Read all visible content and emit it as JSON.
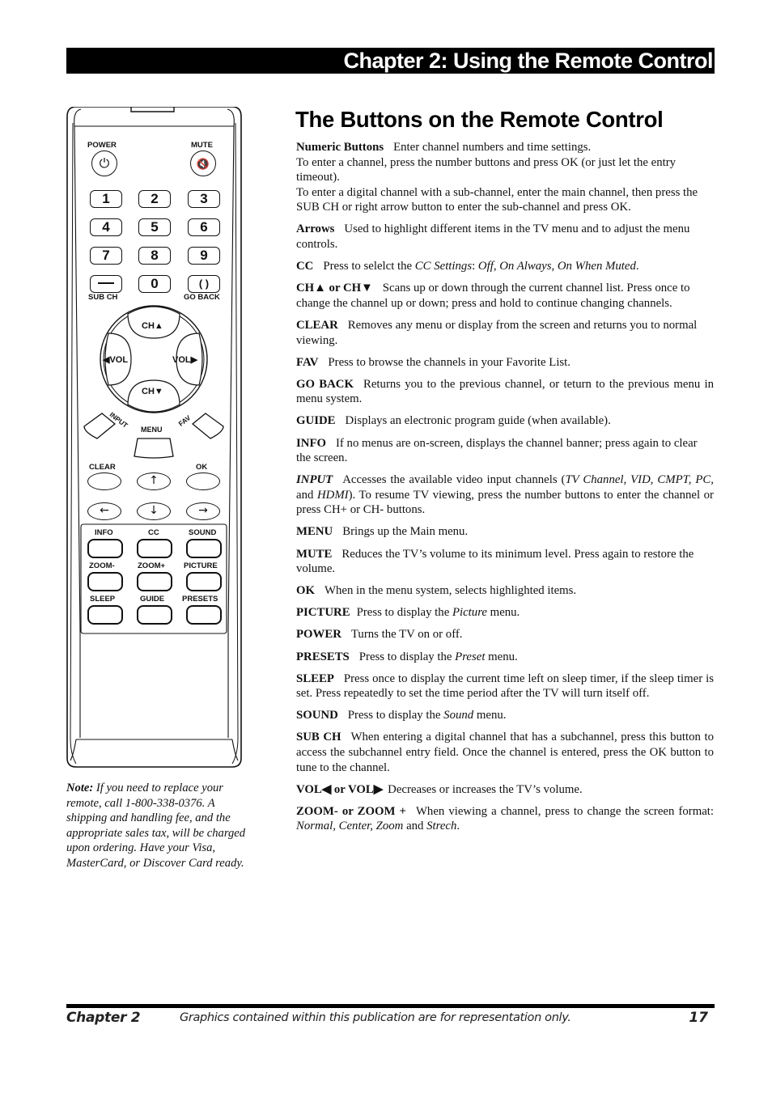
{
  "header": {
    "chapter_title": "Chapter 2: Using the Remote Control"
  },
  "remote": {
    "power_label": "POWER",
    "mute_label": "MUTE",
    "numbers": [
      "1",
      "2",
      "3",
      "4",
      "5",
      "6",
      "7",
      "8",
      "9"
    ],
    "zero": "0",
    "sub_ch_label": "SUB CH",
    "go_back_label": "GO BACK",
    "ch_up_label": "CH▲",
    "ch_down_label": "CH▼",
    "vol_left_label": "◀VOL",
    "vol_right_label": "VOL▶",
    "input_label": "INPUT",
    "menu_label": "MENU",
    "fav_label": "FAV",
    "clear_label": "CLEAR",
    "ok_label": "OK",
    "up_arrow": "↑",
    "down_arrow": "↓",
    "left_arrow": "←",
    "right_arrow": "→",
    "grid_labels": [
      "INFO",
      "CC",
      "SOUND",
      "ZOOM-",
      "ZOOM+",
      "PICTURE",
      "SLEEP",
      "GUIDE",
      "PRESETS"
    ]
  },
  "note": {
    "label": "Note:",
    "text": " If you need to replace your remote, call 1-800-338-0376. A shipping and handling fee, and the appropriate sales tax, will be charged upon ordering. Have your Visa, MasterCard, or Discover Card ready."
  },
  "main": {
    "title": "The Buttons on the Remote Control",
    "numeric": {
      "term": "Numeric Buttons",
      "line1": "Enter channel numbers and time settings.",
      "line2": "To enter a channel, press the number buttons and press OK (or just let the entry timeout).",
      "line3": "To enter a digital channel with a sub-channel, enter the main channel, then press the SUB CH or right arrow button to enter the sub-channel and press OK."
    },
    "arrows": {
      "term": "Arrows",
      "desc": "Used to highlight different items in the TV menu and to adjust the menu controls."
    },
    "cc": {
      "term": "CC",
      "desc_pre": "Press to selelct the ",
      "desc_it": "CC Settings",
      "desc_mid": ": ",
      "desc_it2": "Off, On Always, On When Muted",
      "desc_post": "."
    },
    "ch": {
      "term": "CH▲  or CH▼",
      "desc": "Scans up or down through the current channel list. Press once to change the channel up or down; press and hold to continue changing channels."
    },
    "clear": {
      "term": "CLEAR",
      "desc": "Removes any menu or display from the screen and returns you to normal viewing."
    },
    "fav": {
      "term": "FAV",
      "desc": "Press to browse the channels in your Favorite List."
    },
    "go_back": {
      "term": "GO BACK",
      "desc": "Returns you to the previous channel, or teturn to the previous menu in menu system."
    },
    "guide": {
      "term": "GUIDE",
      "desc": "Displays an electronic program guide (when available)."
    },
    "info": {
      "term": "INFO",
      "desc": "If no menus are on-screen, displays the channel banner; press again to clear the screen."
    },
    "input": {
      "term": "INPUT",
      "desc_pre": "Accesses the available video input channels (",
      "desc_it1": "TV Channel, VID, CMPT, PC,",
      "desc_and": " and ",
      "desc_it2": "HDMI",
      "desc_post": "). To resume TV viewing, press the number buttons to enter the channel or press CH+ or CH- buttons."
    },
    "menu": {
      "term": "MENU",
      "desc": "Brings up the Main menu."
    },
    "mute": {
      "term": "MUTE",
      "desc": "Reduces the TV’s volume to its minimum level. Press again to restore the volume."
    },
    "ok": {
      "term": "OK",
      "desc": "When in the menu system, selects highlighted items."
    },
    "picture": {
      "term": "PICTURE",
      "desc_pre": "Press to display the ",
      "desc_it": "Picture",
      "desc_post": " menu."
    },
    "power": {
      "term": "POWER",
      "desc": "Turns the TV on or off."
    },
    "presets": {
      "term": "PRESETS",
      "desc_pre": "Press to display the ",
      "desc_it": "Preset",
      "desc_post": " menu."
    },
    "sleep": {
      "term": "SLEEP",
      "desc": "Press once to display the current time left on sleep timer, if the sleep timer is set. Press repeatedly to set the time period after the TV will turn itself off."
    },
    "sound": {
      "term": "SOUND",
      "desc_pre": "Press to display the ",
      "desc_it": "Sound",
      "desc_post": " menu."
    },
    "sub_ch": {
      "term": "SUB CH",
      "desc": "When entering a digital channel that has a subchannel, press this button to access the subchannel entry field. Once the channel is entered, press the OK button to tune to the channel."
    },
    "vol": {
      "term": "VOL◀ or VOL▶",
      "desc": "Decreases or increases the TV’s volume."
    },
    "zoom": {
      "term": "ZOOM- or ZOOM +",
      "desc_pre": "When viewing a channel, press to change the screen format: ",
      "desc_it": "Normal, Center, Zoom",
      "desc_and": " and ",
      "desc_it2": "Strech",
      "desc_post": "."
    }
  },
  "footer": {
    "chapter": "Chapter 2",
    "disclaimer": "Graphics contained within this publication are for representation only.",
    "page_number": "17"
  }
}
